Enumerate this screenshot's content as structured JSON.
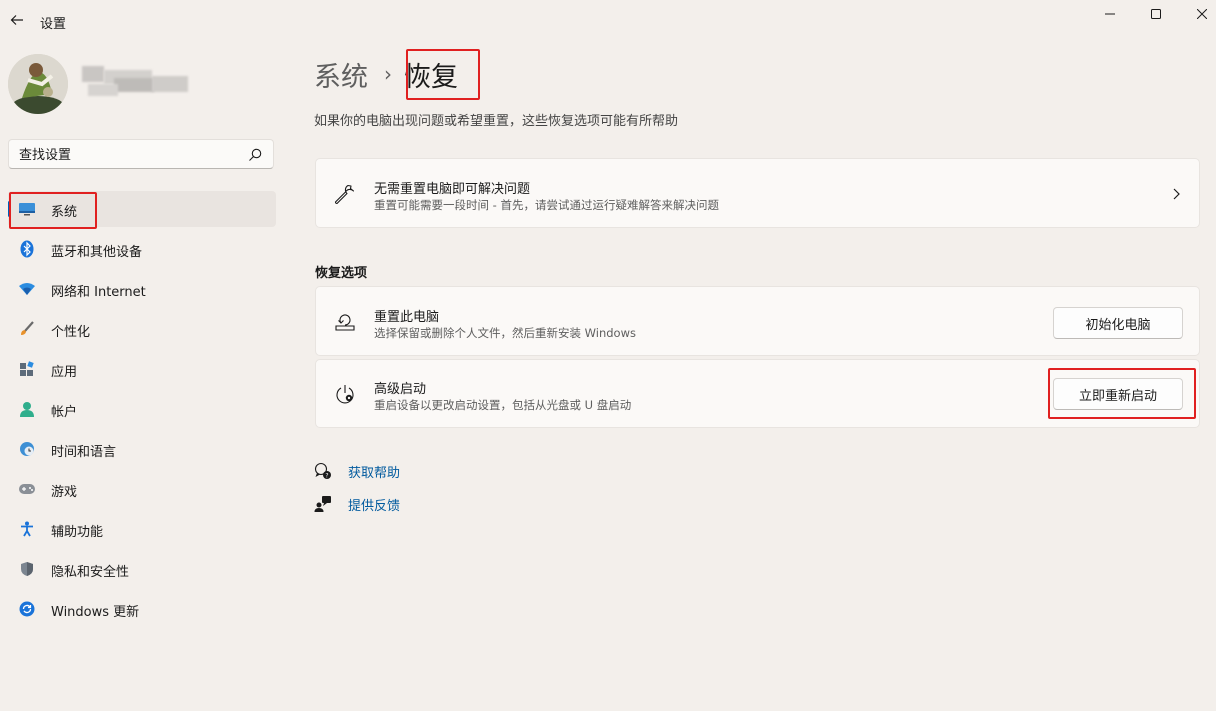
{
  "window": {
    "title": "设置",
    "controls": [
      "minimize",
      "maximize",
      "close"
    ]
  },
  "sidebar": {
    "search_placeholder": "查找设置",
    "items": [
      {
        "label": "系统",
        "icon": "display-icon",
        "active": true
      },
      {
        "label": "蓝牙和其他设备",
        "icon": "bluetooth-icon"
      },
      {
        "label": "网络和 Internet",
        "icon": "wifi-icon"
      },
      {
        "label": "个性化",
        "icon": "brush-icon"
      },
      {
        "label": "应用",
        "icon": "apps-icon"
      },
      {
        "label": "帐户",
        "icon": "person-icon"
      },
      {
        "label": "时间和语言",
        "icon": "globe-clock-icon"
      },
      {
        "label": "游戏",
        "icon": "gamepad-icon"
      },
      {
        "label": "辅助功能",
        "icon": "accessibility-icon"
      },
      {
        "label": "隐私和安全性",
        "icon": "shield-icon"
      },
      {
        "label": "Windows 更新",
        "icon": "update-icon"
      }
    ]
  },
  "main": {
    "breadcrumb_parent": "系统",
    "breadcrumb_separator": "›",
    "breadcrumb_current": "恢复",
    "subtitle": "如果你的电脑出现问题或希望重置，这些恢复选项可能有所帮助",
    "fix_card": {
      "title": "无需重置电脑即可解决问题",
      "desc": "重置可能需要一段时间 - 首先，请尝试通过运行疑难解答来解决问题"
    },
    "section_title": "恢复选项",
    "reset_card": {
      "title": "重置此电脑",
      "desc": "选择保留或删除个人文件，然后重新安装 Windows",
      "button": "初始化电脑"
    },
    "advanced_card": {
      "title": "高级启动",
      "desc": "重启设备以更改启动设置，包括从光盘或 U 盘启动",
      "button": "立即重新启动"
    },
    "links": {
      "help": "获取帮助",
      "feedback": "提供反馈"
    }
  },
  "colors": {
    "accent": "#005fb8",
    "highlight_box": "#e02020",
    "link": "#005a9e",
    "background": "#f3efeb"
  }
}
